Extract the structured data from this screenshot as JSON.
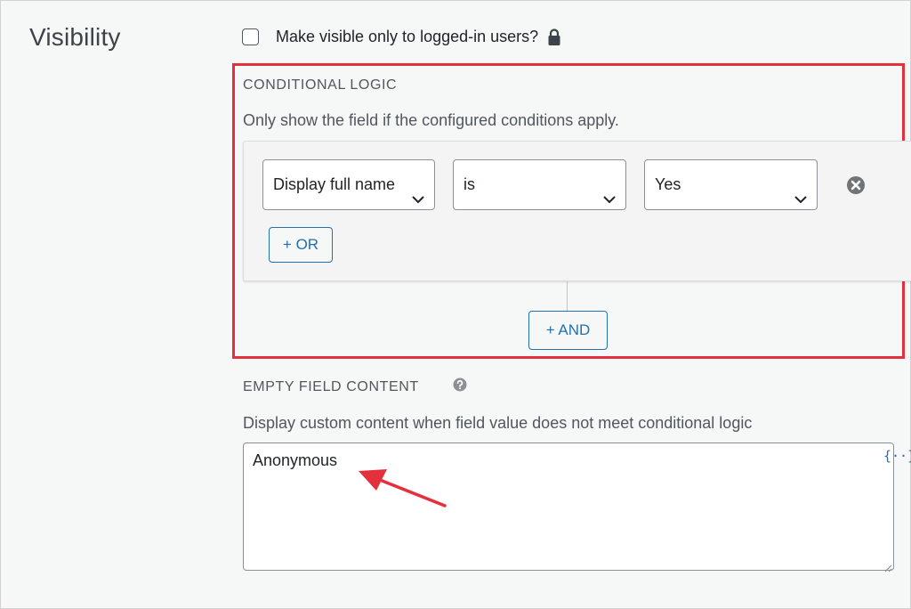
{
  "visibility": {
    "title": "Visibility",
    "checkbox_label": "Make visible only to logged-in users?"
  },
  "conditional_logic": {
    "heading": "CONDITIONAL LOGIC",
    "description": "Only show the field if the configured conditions apply.",
    "condition": {
      "field": "Display full name",
      "operator": "is",
      "value": "Yes"
    },
    "or_button": "+ OR",
    "and_button": "+ AND"
  },
  "empty_field_content": {
    "heading": "EMPTY FIELD CONTENT",
    "description": "Display custom content when field value does not meet conditional logic",
    "value": "Anonymous",
    "merge_tag_icon": "{··}"
  },
  "colors": {
    "highlight": "#e3303c",
    "accent": "#2271b1",
    "arrow": "#e3303c"
  },
  "icons": {
    "lock": "lock-icon",
    "remove": "remove-condition-icon",
    "help": "help-icon",
    "chevron": "chevron-down-icon"
  }
}
